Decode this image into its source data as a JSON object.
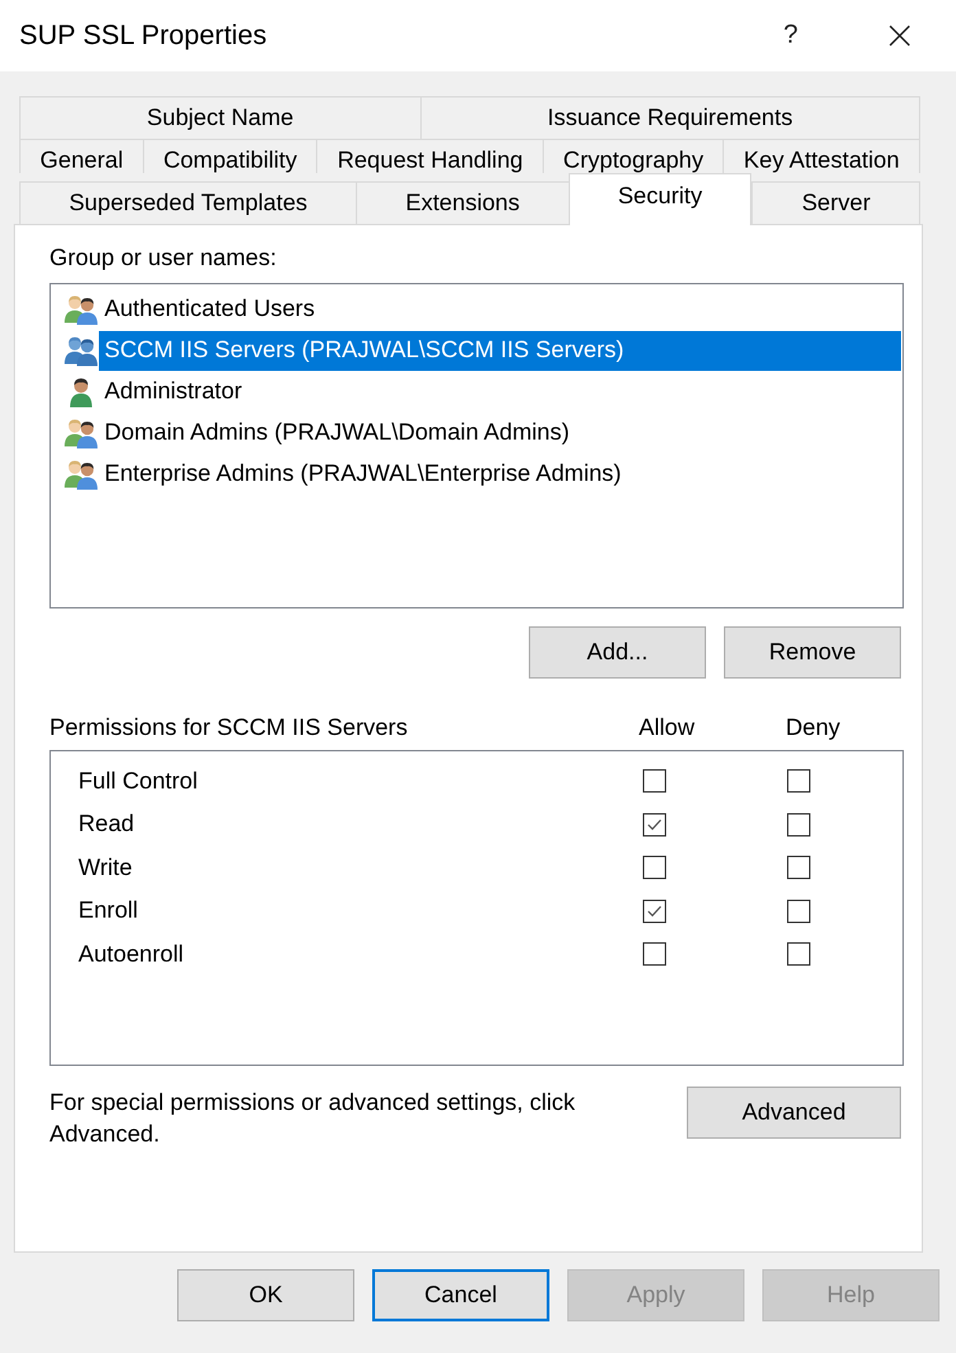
{
  "window": {
    "title": "SUP SSL Properties",
    "help": "?"
  },
  "tab_rows": [
    {
      "tabs": [
        {
          "label": "Subject Name",
          "selected": false
        },
        {
          "label": "Issuance Requirements",
          "selected": false
        }
      ]
    },
    {
      "tabs": [
        {
          "label": "General",
          "selected": false
        },
        {
          "label": "Compatibility",
          "selected": false
        },
        {
          "label": "Request Handling",
          "selected": false
        },
        {
          "label": "Cryptography",
          "selected": false
        },
        {
          "label": "Key Attestation",
          "selected": false
        }
      ]
    },
    {
      "tabs": [
        {
          "label": "Superseded Templates",
          "selected": false
        },
        {
          "label": "Extensions",
          "selected": false
        },
        {
          "label": "Security",
          "selected": true
        },
        {
          "label": "Server",
          "selected": false
        }
      ]
    }
  ],
  "principals": {
    "label": "Group or user names:",
    "items": [
      {
        "name": "Authenticated Users",
        "kind": "group",
        "selected": false
      },
      {
        "name": "SCCM IIS Servers (PRAJWAL\\SCCM IIS Servers)",
        "kind": "group",
        "selected": true
      },
      {
        "name": "Administrator",
        "kind": "user",
        "selected": false
      },
      {
        "name": "Domain Admins (PRAJWAL\\Domain Admins)",
        "kind": "group",
        "selected": false
      },
      {
        "name": "Enterprise Admins (PRAJWAL\\Enterprise Admins)",
        "kind": "group",
        "selected": false
      }
    ]
  },
  "principal_buttons": [
    "Add...",
    "Remove"
  ],
  "permissions": {
    "label": "Permissions for SCCM IIS Servers",
    "columns": [
      "Allow",
      "Deny"
    ],
    "rows": [
      {
        "name": "Full Control",
        "allow": false,
        "deny": false
      },
      {
        "name": "Read",
        "allow": true,
        "deny": false
      },
      {
        "name": "Write",
        "allow": false,
        "deny": false
      },
      {
        "name": "Enroll",
        "allow": true,
        "deny": false
      },
      {
        "name": "Autoenroll",
        "allow": false,
        "deny": false
      }
    ]
  },
  "advanced": {
    "text": "For special permissions or advanced settings, click Advanced.",
    "button": "Advanced"
  },
  "dialog_buttons": [
    {
      "label": "OK",
      "focused": false,
      "disabled": false
    },
    {
      "label": "Cancel",
      "focused": true,
      "disabled": false
    },
    {
      "label": "Apply",
      "focused": false,
      "disabled": true
    },
    {
      "label": "Help",
      "focused": false,
      "disabled": true
    }
  ]
}
